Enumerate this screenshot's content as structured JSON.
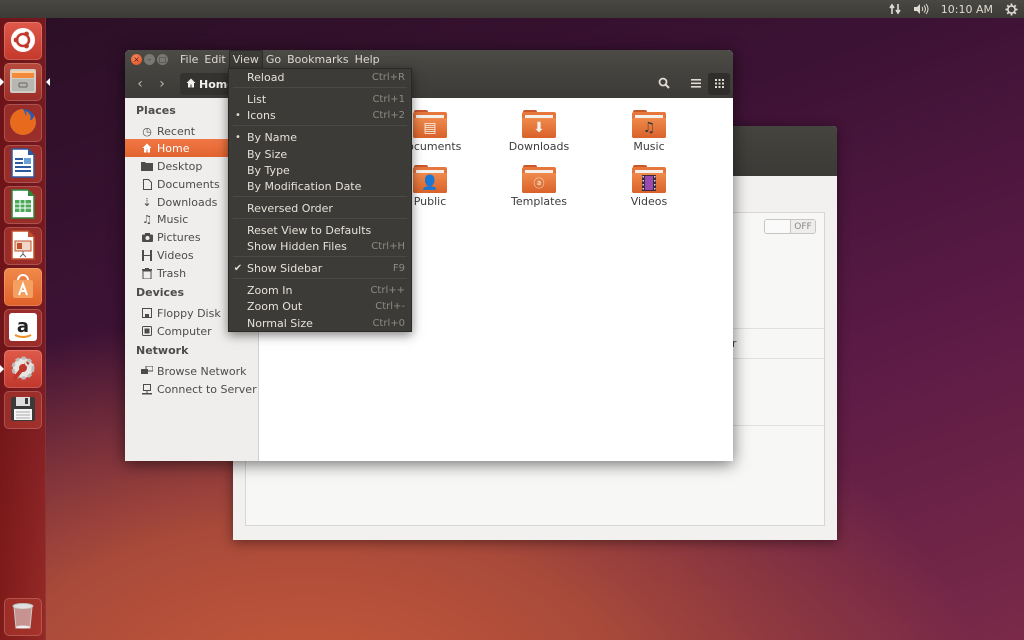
{
  "top_panel": {
    "network_icon": "network-updown-icon",
    "volume_icon": "volume-icon",
    "clock": "10:10 AM",
    "settings_icon": "gear-icon"
  },
  "launcher": {
    "items": [
      {
        "name": "Dash Home",
        "icon": "ubuntu-logo-icon"
      },
      {
        "name": "Files",
        "icon": "file-cabinet-icon",
        "running": true
      },
      {
        "name": "Firefox Web Browser",
        "icon": "firefox-icon"
      },
      {
        "name": "LibreOffice Writer",
        "icon": "writer-icon"
      },
      {
        "name": "LibreOffice Calc",
        "icon": "calc-icon"
      },
      {
        "name": "LibreOffice Impress",
        "icon": "impress-icon"
      },
      {
        "name": "Ubuntu Software Center",
        "icon": "software-center-icon"
      },
      {
        "name": "Amazon",
        "icon": "amazon-icon"
      },
      {
        "name": "System Settings",
        "icon": "system-settings-icon",
        "running": true
      },
      {
        "name": "Floppy Disk",
        "icon": "floppy-icon"
      }
    ],
    "trash": {
      "name": "Trash",
      "icon": "trash-icon"
    }
  },
  "background_window": {
    "switch_label": "OFF",
    "partial_text": "r"
  },
  "nautilus": {
    "menubar": [
      "File",
      "Edit",
      "View",
      "Go",
      "Bookmarks",
      "Help"
    ],
    "active_menu": "View",
    "path_button": "Home",
    "sidebar": {
      "places_heading": "Places",
      "places": [
        {
          "label": "Recent",
          "icon": "clock-icon"
        },
        {
          "label": "Home",
          "icon": "home-icon",
          "selected": true
        },
        {
          "label": "Desktop",
          "icon": "desktop-folder-icon"
        },
        {
          "label": "Documents",
          "icon": "document-icon"
        },
        {
          "label": "Downloads",
          "icon": "download-icon"
        },
        {
          "label": "Music",
          "icon": "music-icon"
        },
        {
          "label": "Pictures",
          "icon": "camera-icon"
        },
        {
          "label": "Videos",
          "icon": "film-icon"
        },
        {
          "label": "Trash",
          "icon": "trash-icon"
        }
      ],
      "devices_heading": "Devices",
      "devices": [
        {
          "label": "Floppy Disk",
          "icon": "floppy-icon"
        },
        {
          "label": "Computer",
          "icon": "computer-icon"
        }
      ],
      "network_heading": "Network",
      "network": [
        {
          "label": "Browse Network",
          "icon": "network-icon"
        },
        {
          "label": "Connect to Server",
          "icon": "server-icon"
        }
      ]
    },
    "files": [
      {
        "name": "Documents",
        "glyph": "document"
      },
      {
        "name": "Downloads",
        "glyph": "download"
      },
      {
        "name": "Music",
        "glyph": "music"
      },
      {
        "name": "Public",
        "glyph": "person"
      },
      {
        "name": "Templates",
        "glyph": "template"
      },
      {
        "name": "Videos",
        "glyph": "film"
      }
    ]
  },
  "view_menu": {
    "items": [
      {
        "label": "Reload",
        "accel": "Ctrl+R",
        "mark": ""
      },
      {
        "label": "List",
        "accel": "Ctrl+1",
        "mark": ""
      },
      {
        "label": "Icons",
        "accel": "Ctrl+2",
        "mark": "•"
      },
      {
        "label": "By Name",
        "accel": "",
        "mark": "•"
      },
      {
        "label": "By Size",
        "accel": "",
        "mark": ""
      },
      {
        "label": "By Type",
        "accel": "",
        "mark": ""
      },
      {
        "label": "By Modification Date",
        "accel": "",
        "mark": ""
      },
      {
        "label": "Reversed Order",
        "accel": "",
        "mark": ""
      },
      {
        "label": "Reset View to Defaults",
        "accel": "",
        "mark": ""
      },
      {
        "label": "Show Hidden Files",
        "accel": "Ctrl+H",
        "mark": ""
      },
      {
        "label": "Show Sidebar",
        "accel": "F9",
        "mark": "✔"
      },
      {
        "label": "Zoom In",
        "accel": "Ctrl++",
        "mark": ""
      },
      {
        "label": "Zoom Out",
        "accel": "Ctrl+-",
        "mark": ""
      },
      {
        "label": "Normal Size",
        "accel": "Ctrl+0",
        "mark": ""
      }
    ]
  },
  "colors": {
    "accent_orange": "#e8683a",
    "panel_dark": "#3c3b37",
    "text_light": "#dfdbd2"
  }
}
